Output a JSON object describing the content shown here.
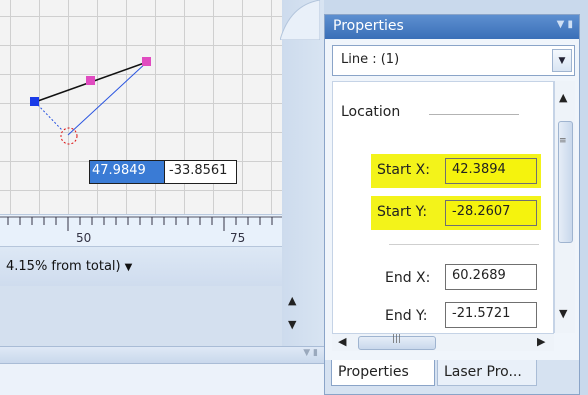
{
  "canvas": {
    "coord_x": "47.9849",
    "coord_y": "-33.8561",
    "colors": {
      "line_black": "#111111",
      "line_blue": "#2a55e0",
      "handle_blue": "#1a3be8",
      "handle_pink": "#e04bc0",
      "circle_red": "#dd1111"
    }
  },
  "ruler": {
    "labels": [
      "50",
      "75"
    ]
  },
  "status": {
    "text": "4.15% from total)"
  },
  "properties": {
    "title": "Properties",
    "object_select": "Line : (1)",
    "category": "Location",
    "rows": [
      {
        "label": "Start X:",
        "value": "42.3894",
        "highlighted": true
      },
      {
        "label": "Start Y:",
        "value": "-28.2607",
        "highlighted": true
      },
      {
        "label": "End X:",
        "value": "60.2689",
        "highlighted": false
      },
      {
        "label": "End Y:",
        "value": "-21.5721",
        "highlighted": false
      }
    ],
    "tabs": [
      "Properties",
      "Laser Pro..."
    ]
  },
  "colors": {
    "highlight": "#f3f31a",
    "titlebar": "#3a6fb8"
  }
}
